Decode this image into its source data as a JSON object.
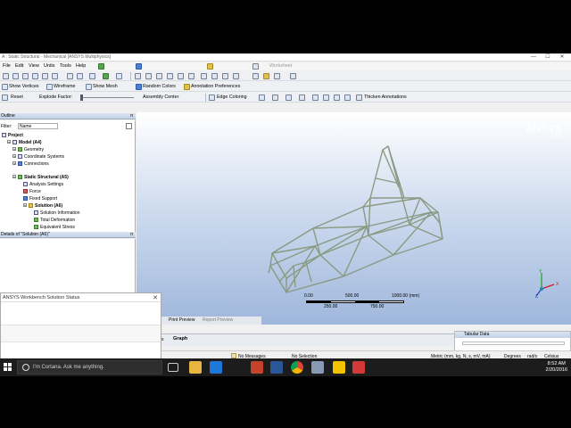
{
  "window": {
    "title": "A : Static Structural - Mechanical [ANSYS Multiphysics]",
    "minimize": "—",
    "maximize": "☐",
    "close": "✕"
  },
  "menu": [
    "File",
    "Edit",
    "View",
    "Units",
    "Tools",
    "Help"
  ],
  "toolbar1": {
    "worksheet": "Worksheet"
  },
  "toolbar2": {
    "show_vertices": "Show Vertices",
    "wireframe": "Wireframe",
    "show_mesh": "Show Mesh",
    "random_colors": "Random Colors",
    "annotation_preferences": "Annotation Preferences"
  },
  "toolbar3": {
    "reset": "Reset",
    "explode_factor": "Explode Factor:",
    "assembly_center": "Assembly Center",
    "edge_coloring": "Edge Coloring",
    "thicken_annotations": "Thicken Annotations"
  },
  "outline": {
    "header": "Outline",
    "filter_label": "Filter:",
    "filter_value": "Name",
    "tree": [
      {
        "label": "Project",
        "bold": true
      },
      {
        "label": "Model (A4)",
        "bold": true
      },
      {
        "label": "Geometry"
      },
      {
        "label": "Coordinate Systems"
      },
      {
        "label": "Connections"
      },
      {
        "label": "Static Structural (A5)",
        "bold": true
      },
      {
        "label": "Analysis Settings"
      },
      {
        "label": "Force"
      },
      {
        "label": "Fixed Support"
      },
      {
        "label": "Solution (A6)",
        "bold": true
      },
      {
        "label": "Solution Information"
      },
      {
        "label": "Total Deformation"
      },
      {
        "label": "Equivalent Stress"
      }
    ]
  },
  "details": {
    "header": "Details of \"Solution (A6)\""
  },
  "viewport": {
    "brand": "ANSYS",
    "version": "16.0",
    "scale_labels": [
      "0.00",
      "500.00",
      "1000.00 (mm)",
      "250.00",
      "750.00"
    ],
    "axes": {
      "x": "X",
      "y": "Y",
      "z": "Z"
    }
  },
  "bottom_tabs": {
    "print_preview": "Print Preview",
    "report_preview": "Report Preview"
  },
  "status_window": {
    "title": "ANSYS Workbench Solution Status",
    "close": "✕"
  },
  "graph_tabs": {
    "messages": "Messages",
    "graph": "Graph"
  },
  "tabular": {
    "title": "Tabular Data"
  },
  "statusbar": {
    "messages": "No Messages",
    "selection": "No Selection",
    "units": "Metric (mm, kg, N, s, mV, mA)",
    "degrees": "Degrees",
    "rads": "rad/s",
    "celsius": "Celsius"
  },
  "taskbar": {
    "cortana_placeholder": "I'm Cortana. Ask me anything.",
    "time": "8:52 AM",
    "date": "2/20/2016"
  }
}
